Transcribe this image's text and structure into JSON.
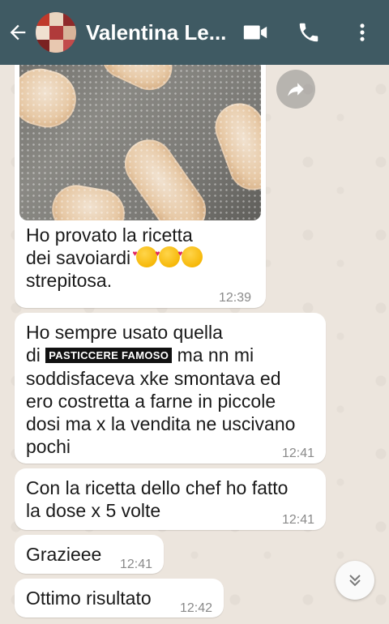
{
  "header": {
    "contact_name": "Valentina Le...",
    "back_icon": "arrow-left-icon",
    "video_icon": "video-call-icon",
    "call_icon": "phone-icon",
    "menu_icon": "more-vertical-icon",
    "color": "#3f5a63"
  },
  "messages": [
    {
      "lines": [
        "Ho provato la ricetta",
        "dei savoiardi",
        "strepitosa."
      ],
      "emoji": "smiling-face-with-hearts ×3",
      "time": "12:39",
      "has_image": true
    },
    {
      "line1": "Ho sempre usato quella",
      "line2_pre": "di",
      "redacted": "PASTICCERE FAMOSO",
      "line2_post": "ma nn mi",
      "line3": "soddisfaceva xke smontava ed",
      "line4": "ero costretta a farne in piccole",
      "line5": "dosi ma x la vendita ne uscivano",
      "line6": "pochi",
      "time": "12:41"
    },
    {
      "lines": [
        "Con la ricetta dello chef ho fatto",
        "la dose x 5 volte"
      ],
      "time": "12:41"
    },
    {
      "text": "Grazieee",
      "time": "12:41"
    },
    {
      "text": "Ottimo risultato",
      "time": "12:42"
    }
  ],
  "controls": {
    "share_icon": "forward-share-icon",
    "scroll_icon": "double-chevron-down-icon"
  },
  "colors": {
    "chat_bg": "#ece5dd",
    "bubble": "#ffffff",
    "time_text": "#8a8a8a"
  }
}
